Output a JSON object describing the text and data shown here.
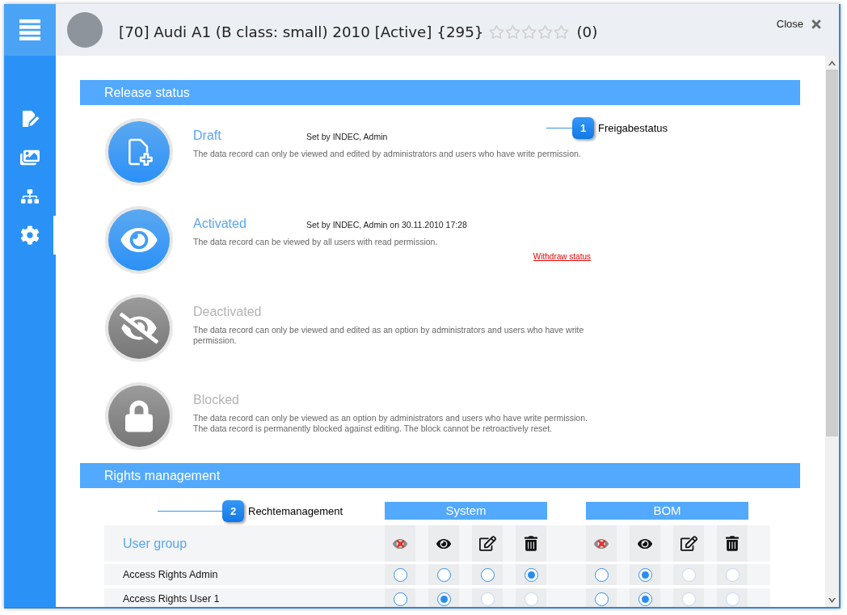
{
  "header": {
    "title": "[70] Audi A1 (B class: small) 2010 [Active] {295}",
    "stars": 0,
    "rating_count": "(0)",
    "close_label": "Close"
  },
  "sidebar": {
    "items": [
      {
        "kind": "edit",
        "selected": false
      },
      {
        "kind": "images",
        "selected": false
      },
      {
        "kind": "hierarchy",
        "selected": false
      },
      {
        "kind": "settings",
        "selected": true
      }
    ]
  },
  "release_status": {
    "title": "Release status",
    "callout": {
      "number": "1",
      "label": "Freigabestatus"
    },
    "statuses": [
      {
        "kind": "draft",
        "name": "Draft",
        "reached": true,
        "set_by": "Set by INDEC, Admin",
        "description": "The data record can only be viewed and edited by administrators and users who have write permission."
      },
      {
        "kind": "activated",
        "name": "Activated",
        "reached": true,
        "set_by": "Set by INDEC, Admin on 30.11.2010 17:28",
        "description": "The data record can be viewed by all users with read permission.",
        "link": "Withdraw status"
      },
      {
        "kind": "deactivated",
        "name": "Deactivated",
        "reached": false,
        "description": "The data record can only be viewed and edited as an option by administrators and users who have write permission."
      },
      {
        "kind": "blocked",
        "name": "Blocked",
        "reached": false,
        "description": "The data record can only be viewed as an option by administrators and users who have write permission. The data record is permanently blocked against editing. The block cannot be retroactively reset."
      }
    ]
  },
  "rights_management": {
    "title": "Rights management",
    "callout": {
      "number": "2",
      "label": "Rechtemanagement"
    },
    "column_header": "User group",
    "groups": [
      {
        "name": "System",
        "permissions": [
          {
            "kind": "none"
          },
          {
            "kind": "read"
          },
          {
            "kind": "write"
          },
          {
            "kind": "delete"
          }
        ]
      },
      {
        "name": "BOM",
        "permissions": [
          {
            "kind": "none"
          },
          {
            "kind": "read"
          },
          {
            "kind": "write"
          },
          {
            "kind": "delete"
          }
        ]
      }
    ],
    "rows": [
      {
        "name": "Access Rights Admin",
        "groups": [
          {
            "options": [
              {
                "selected": false,
                "disabled": false
              },
              {
                "selected": false,
                "disabled": false
              },
              {
                "selected": false,
                "disabled": false
              },
              {
                "selected": true,
                "disabled": false
              }
            ]
          },
          {
            "options": [
              {
                "selected": false,
                "disabled": false
              },
              {
                "selected": true,
                "disabled": false
              },
              {
                "selected": false,
                "disabled": true
              },
              {
                "selected": false,
                "disabled": true
              }
            ]
          }
        ]
      },
      {
        "name": "Access Rights User 1",
        "groups": [
          {
            "options": [
              {
                "selected": false,
                "disabled": false
              },
              {
                "selected": true,
                "disabled": false
              },
              {
                "selected": false,
                "disabled": true
              },
              {
                "selected": false,
                "disabled": true
              }
            ]
          },
          {
            "options": [
              {
                "selected": false,
                "disabled": false
              },
              {
                "selected": true,
                "disabled": false
              },
              {
                "selected": false,
                "disabled": true
              },
              {
                "selected": false,
                "disabled": true
              }
            ]
          }
        ]
      }
    ]
  }
}
